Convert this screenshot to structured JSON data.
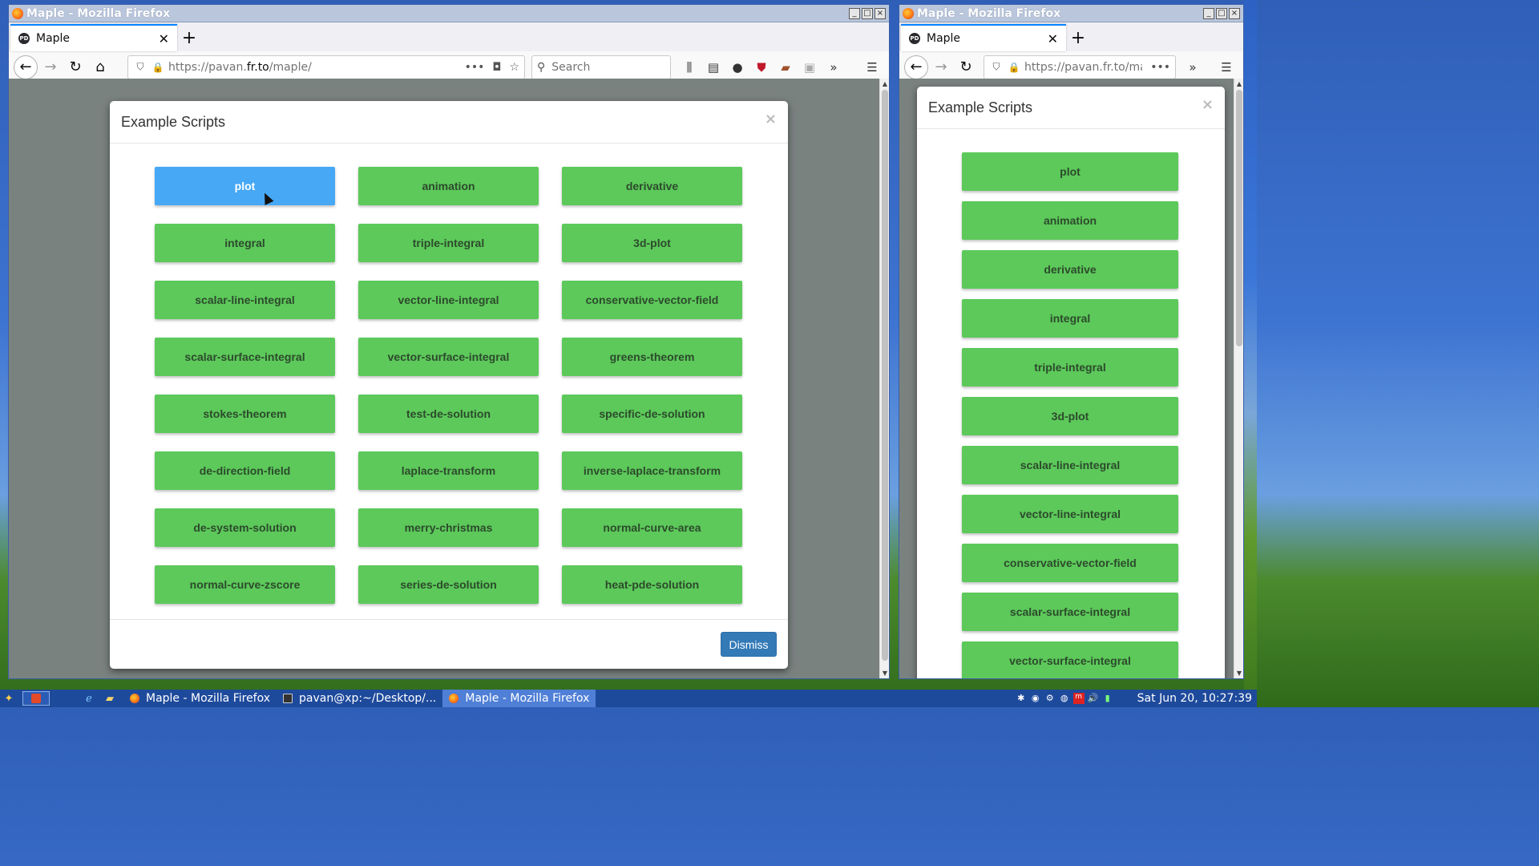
{
  "window_title": "Maple - Mozilla Firefox",
  "tab_label": "Maple",
  "favicon_text": "PD",
  "url": {
    "prefix": "https://pavan.",
    "domain": "fr.to",
    "path": "/maple/"
  },
  "url_right": {
    "full": "https://pavan.fr.to/maple"
  },
  "search_placeholder": "Search",
  "modal": {
    "title": "Example Scripts",
    "close": "×",
    "dismiss": "Dismiss",
    "buttons": [
      "plot",
      "animation",
      "derivative",
      "integral",
      "triple-integral",
      "3d-plot",
      "scalar-line-integral",
      "vector-line-integral",
      "conservative-vector-field",
      "scalar-surface-integral",
      "vector-surface-integral",
      "greens-theorem",
      "stokes-theorem",
      "test-de-solution",
      "specific-de-solution",
      "de-direction-field",
      "laplace-transform",
      "inverse-laplace-transform",
      "de-system-solution",
      "merry-christmas",
      "normal-curve-area",
      "normal-curve-zscore",
      "series-de-solution",
      "heat-pde-solution"
    ],
    "active_button": "plot"
  },
  "right_modal_buttons": [
    "plot",
    "animation",
    "derivative",
    "integral",
    "triple-integral",
    "3d-plot",
    "scalar-line-integral",
    "vector-line-integral",
    "conservative-vector-field",
    "scalar-surface-integral",
    "vector-surface-integral"
  ],
  "taskbar": {
    "tasks": [
      {
        "label": "Maple - Mozilla Firefox",
        "icon": "firefox-icon",
        "active": false
      },
      {
        "label": "pavan@xp:~/Desktop/...",
        "icon": "terminal-icon",
        "active": false
      },
      {
        "label": "Maple - Mozilla Firefox",
        "icon": "firefox-icon",
        "active": true
      }
    ],
    "clock": "Sat Jun 20, 10:27:39"
  },
  "colors": {
    "button_green": "#5cc95a",
    "button_active": "#47a8f5",
    "dismiss_blue": "#337ab7",
    "backdrop": "#7a8280"
  }
}
